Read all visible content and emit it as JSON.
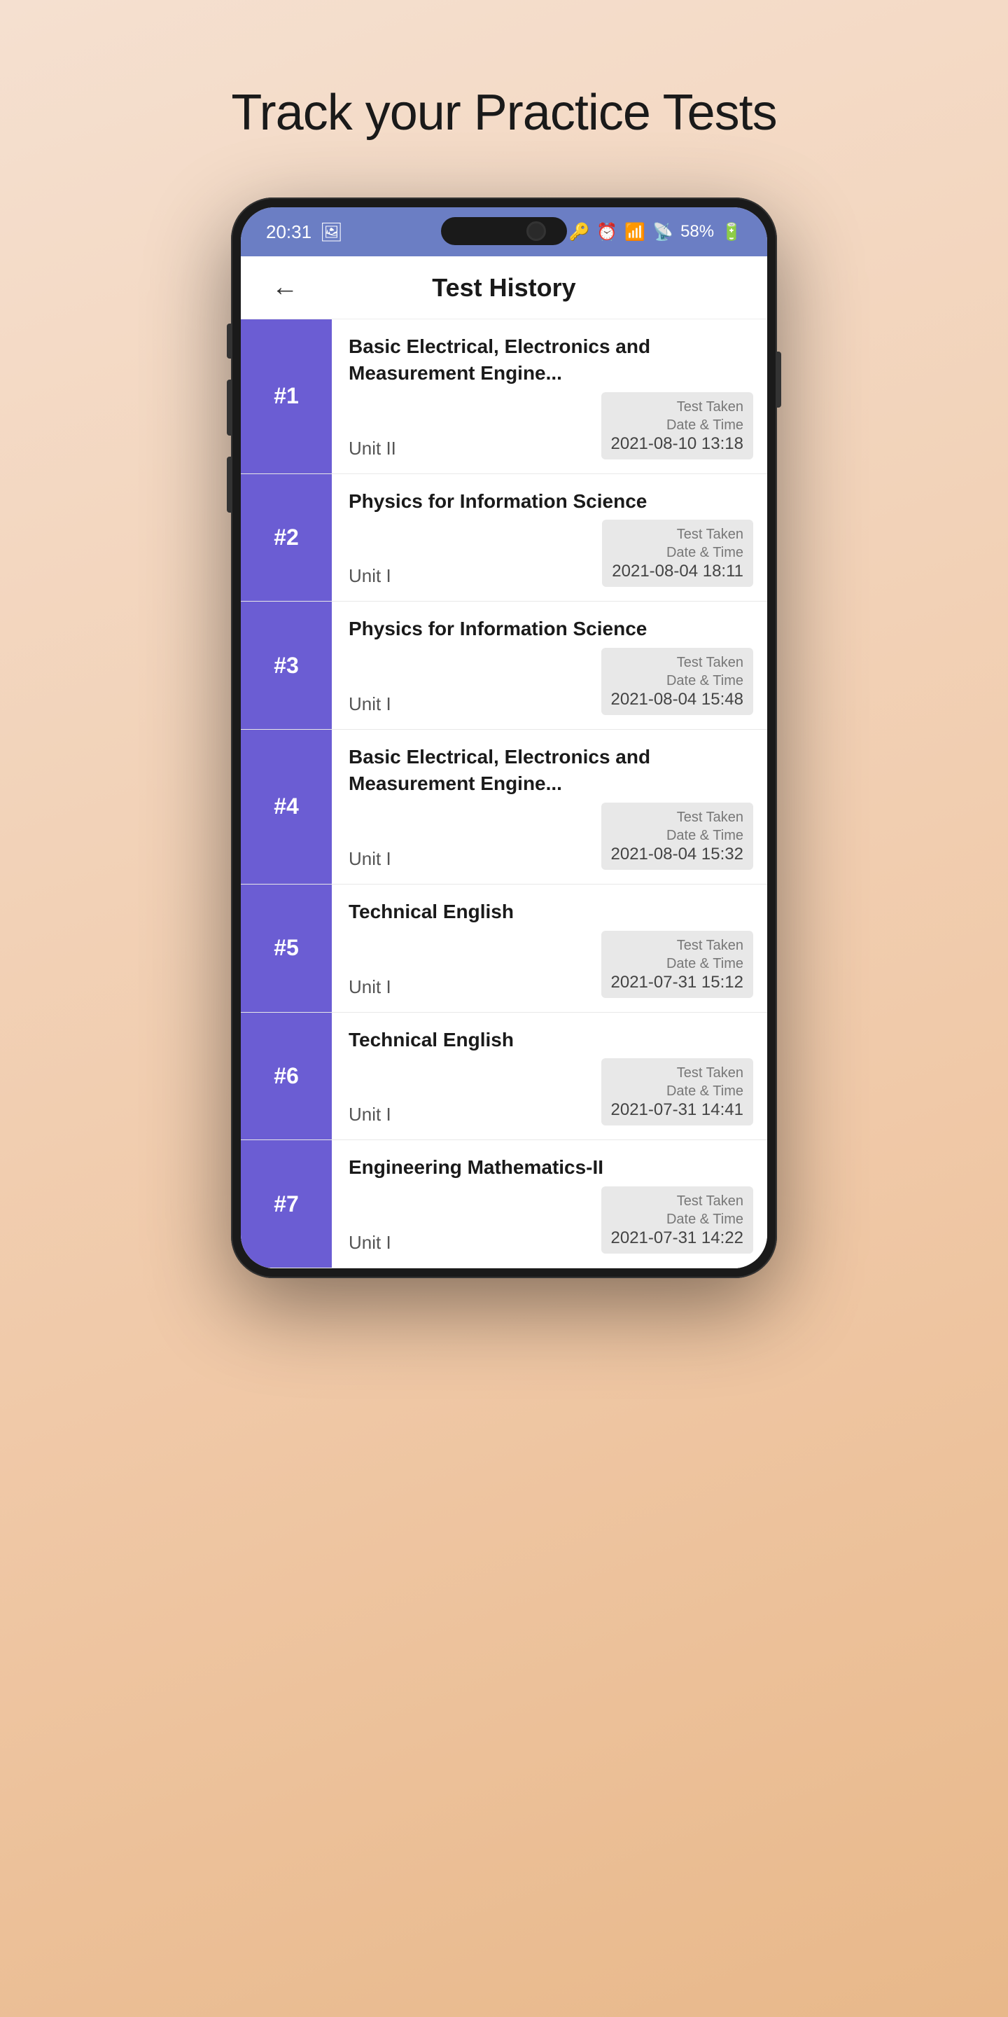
{
  "page": {
    "title": "Track your Practice Tests"
  },
  "statusBar": {
    "time": "20:31",
    "battery": "58%",
    "icons": [
      "image-icon",
      "key-icon",
      "alarm-icon",
      "wifi-icon",
      "signal-icon",
      "battery-icon"
    ]
  },
  "appHeader": {
    "backLabel": "←",
    "title": "Test History"
  },
  "testItems": [
    {
      "number": "#1",
      "subject": "Basic Electrical, Electronics and Measurement Engine...",
      "unit": "Unit II",
      "dateLabel": "Test Taken\nDate & Time",
      "dateValue": "2021-08-10 13:18"
    },
    {
      "number": "#2",
      "subject": "Physics for Information  Science",
      "unit": "Unit I",
      "dateLabel": "Test Taken\nDate & Time",
      "dateValue": "2021-08-04 18:11"
    },
    {
      "number": "#3",
      "subject": "Physics for Information  Science",
      "unit": "Unit I",
      "dateLabel": "Test Taken\nDate & Time",
      "dateValue": "2021-08-04 15:48"
    },
    {
      "number": "#4",
      "subject": "Basic Electrical, Electronics and Measurement Engine...",
      "unit": "Unit I",
      "dateLabel": "Test Taken\nDate & Time",
      "dateValue": "2021-08-04 15:32"
    },
    {
      "number": "#5",
      "subject": "Technical English",
      "unit": "Unit I",
      "dateLabel": "Test Taken\nDate & Time",
      "dateValue": "2021-07-31 15:12"
    },
    {
      "number": "#6",
      "subject": "Technical English",
      "unit": "Unit I",
      "dateLabel": "Test Taken\nDate & Time",
      "dateValue": "2021-07-31 14:41"
    },
    {
      "number": "#7",
      "subject": "Engineering Mathematics-II",
      "unit": "Unit I",
      "dateLabel": "Test Taken\nDate & Time",
      "dateValue": "2021-07-31 14:22"
    }
  ]
}
